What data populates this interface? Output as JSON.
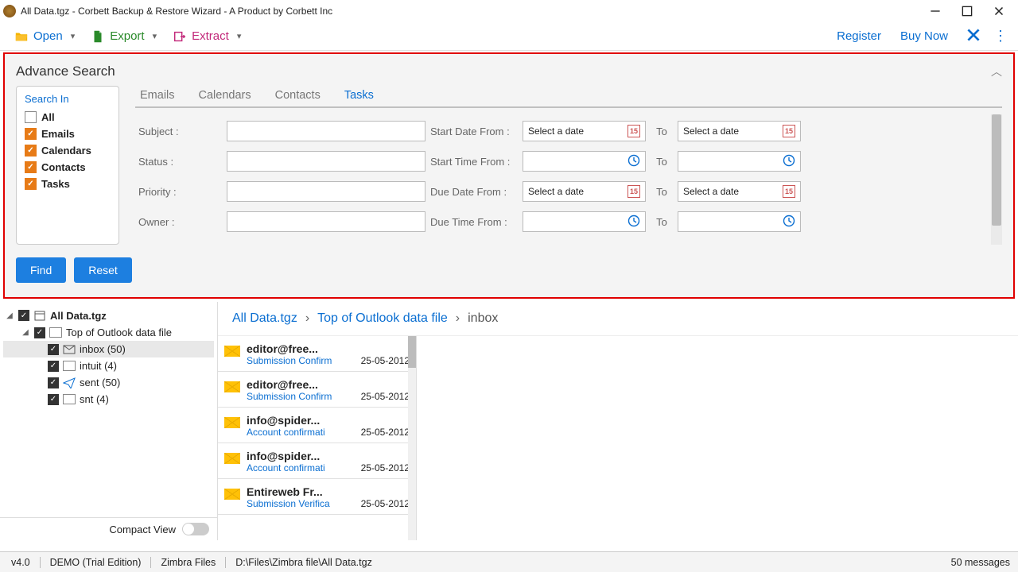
{
  "window": {
    "title": "All Data.tgz - Corbett Backup & Restore Wizard - A Product by Corbett Inc"
  },
  "toolbar": {
    "open": "Open",
    "export": "Export",
    "extract": "Extract",
    "register": "Register",
    "buy": "Buy Now"
  },
  "adv": {
    "title": "Advance Search",
    "search_in_title": "Search In",
    "items": [
      {
        "label": "All",
        "checked": false
      },
      {
        "label": "Emails",
        "checked": true
      },
      {
        "label": "Calendars",
        "checked": true
      },
      {
        "label": "Contacts",
        "checked": true
      },
      {
        "label": "Tasks",
        "checked": true
      }
    ],
    "tabs": [
      "Emails",
      "Calendars",
      "Contacts",
      "Tasks"
    ],
    "active_tab": "Tasks",
    "fields": {
      "subject": "Subject :",
      "status": "Status :",
      "priority": "Priority :",
      "owner": "Owner :",
      "start_date_from": "Start Date From :",
      "start_time_from": "Start Time From :",
      "due_date_from": "Due Date From :",
      "due_time_from": "Due Time From :",
      "to": "To",
      "select_date": "Select a date"
    },
    "find": "Find",
    "reset": "Reset"
  },
  "tree": {
    "root": "All Data.tgz",
    "top": "Top of Outlook data file",
    "items": [
      {
        "name": "inbox",
        "count": "(50)",
        "sel": true
      },
      {
        "name": "intuit",
        "count": "(4)"
      },
      {
        "name": "sent",
        "count": "(50)"
      },
      {
        "name": "snt",
        "count": "(4)"
      }
    ],
    "compact": "Compact View"
  },
  "crumbs": {
    "a": "All Data.tgz",
    "b": "Top of Outlook data file",
    "c": "inbox"
  },
  "messages": [
    {
      "from": "editor@free...",
      "sub": "Submission Confirm",
      "date": "25-05-2012"
    },
    {
      "from": "editor@free...",
      "sub": "Submission Confirm",
      "date": "25-05-2012"
    },
    {
      "from": "info@spider...",
      "sub": "Account confirmati",
      "date": "25-05-2012"
    },
    {
      "from": "info@spider...",
      "sub": "Account confirmati",
      "date": "25-05-2012"
    },
    {
      "from": "Entireweb Fr...",
      "sub": "Submission Verifica",
      "date": "25-05-2012"
    }
  ],
  "status": {
    "ver": "v4.0",
    "edition": "DEMO (Trial Edition)",
    "mode": "Zimbra Files",
    "path": "D:\\Files\\Zimbra file\\All Data.tgz",
    "count": "50  messages"
  }
}
